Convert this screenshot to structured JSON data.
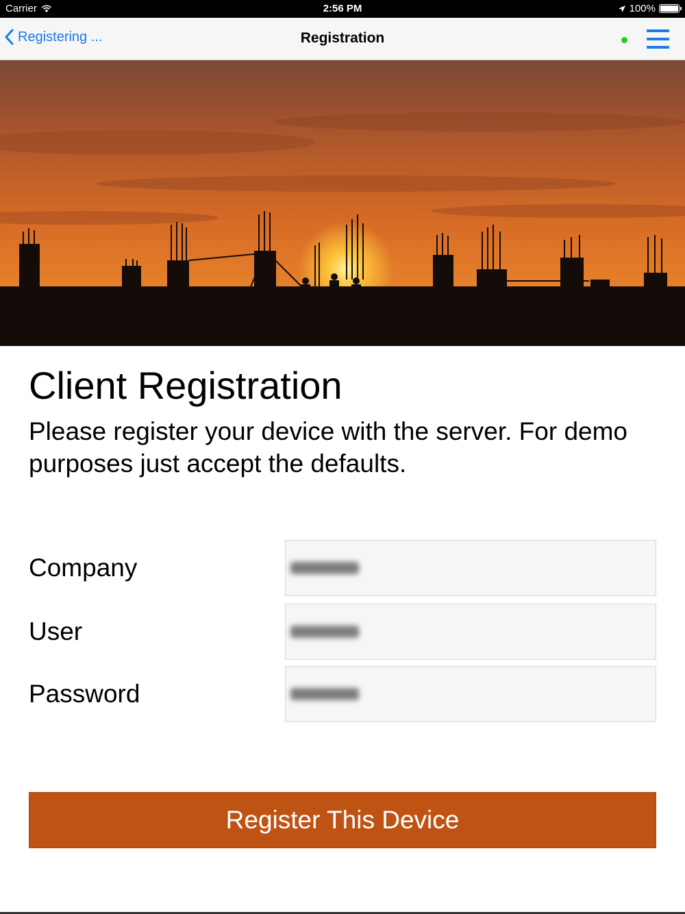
{
  "status_bar": {
    "carrier": "Carrier",
    "time": "2:56 PM",
    "battery": "100%"
  },
  "nav": {
    "back_label": "Registering ...",
    "title": "Registration",
    "connection_color": "#22cc22",
    "accent_color": "#1a7ae6"
  },
  "hero": {
    "icon": "construction-sunset-image"
  },
  "content": {
    "title": "Client Registration",
    "description": "Please register your device with the server. For demo purposes just accept the defaults."
  },
  "form": {
    "fields": [
      {
        "label": "Company"
      },
      {
        "label": "User"
      },
      {
        "label": "Password"
      }
    ]
  },
  "actions": {
    "register_label": "Register This Device",
    "register_color": "#bf5314"
  }
}
